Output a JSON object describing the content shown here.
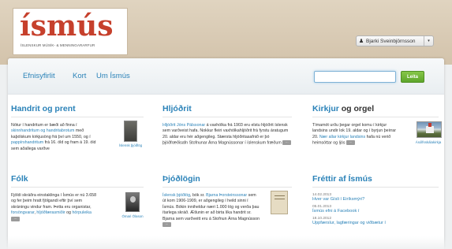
{
  "header": {
    "logo_text": "ísmús",
    "logo_subtitle": "ÍSLENSKUR MÚSÍK- & MENNINGARARFUR",
    "user_name": "Bjarki Sveinbjörnsson",
    "user_caret": "▾"
  },
  "nav": {
    "items": [
      {
        "label": "Efnisyfirlit"
      },
      {
        "label": "Kort"
      },
      {
        "label": "Um Ísmús"
      }
    ],
    "search_value": "",
    "search_button": "Leita"
  },
  "sections": {
    "handrit": {
      "title": "Handrit og prent",
      "t1": "Nótur í handritum er bæði að finna í ",
      "link1": "skinnhandritum og handritabrotum",
      "t2": " með kaþólskum kirkjusöng frá því um 1550, og í ",
      "link2": "pappírshandritum",
      "t3": " frá 16. öld og fram á 19. öld sem aðallega varðve",
      "thumb_caption": "Íslensk þjóðlög"
    },
    "hljodrit": {
      "title": "Hljóðrit",
      "link1": "Hljóðrit Jóns Pálssonar",
      "t1": " á vaxhólka frá 1903 eru elstu hljóðrit íslensk sem varðveist hafa. Nokkur fleiri vaxhólkahljóðrit frá fyrstu áratugum 20. aldar eru hér aðgengileg. Stærsta hljóðritasafnið er þó þjóðfræðisafn Stofnunar Árna Magnússonar í íslenskum fræðum"
    },
    "kirkjur": {
      "title_part1": "Kirkjur",
      "title_part2": " og orgel",
      "t1": "Tímamót urðu þegar orgel komu í kirkjur landsins undir lok 19. aldar og í byrjun þeirrar 20. ",
      "link1": "Nær allar kirkjur landsins",
      "t2": " hafa nú verið heimsóttar og ljós",
      "thumb_caption": "Ásólfsskálakirkja"
    },
    "folk": {
      "title": "Fólk",
      "t1": "Fjöldi skráðra einstaklinga í Ísmús er nú 3.658 og fer þeim hratt fjölgandi eftir því sem skráningu vindur fram. Þetta eru organistar, ",
      "link1": "forsöngvarar",
      "t2": ", ",
      "link2": "hljóðfærasmiðir",
      "t3": " og ",
      "link3": "hörpuleika",
      "thumb_caption": "Ómari Ólason"
    },
    "thjodlog": {
      "title": "Þjóðlögin",
      "link1": "Íslensk þjóðlög",
      "t1": ", bók sr. ",
      "link2": "Bjarna Þorsteinssonar",
      "t2": " sem út kom 1906-1909, er aðgengileg í heild sinni í Ísmús. Bókin inniheldur næri 1.000 lög og verða þau ítarlega skráð. Ætlunin er að birta líka handrit sr. Bjarna sem varðveitt eru á Stofnun Árna Magnússon"
    },
    "frettir": {
      "title": "Fréttir af Ísmús",
      "items": [
        {
          "date": "14.02.2013",
          "title": "Hver var Gísli í Eiríksmýri?"
        },
        {
          "date": "05.01.2013",
          "title": "Ísmús efni á Facebook í"
        },
        {
          "date": "18.10.2012",
          "title": "Uppfærslur, lagfæringar og viðbætur í"
        }
      ]
    }
  },
  "more_glyph": "···"
}
